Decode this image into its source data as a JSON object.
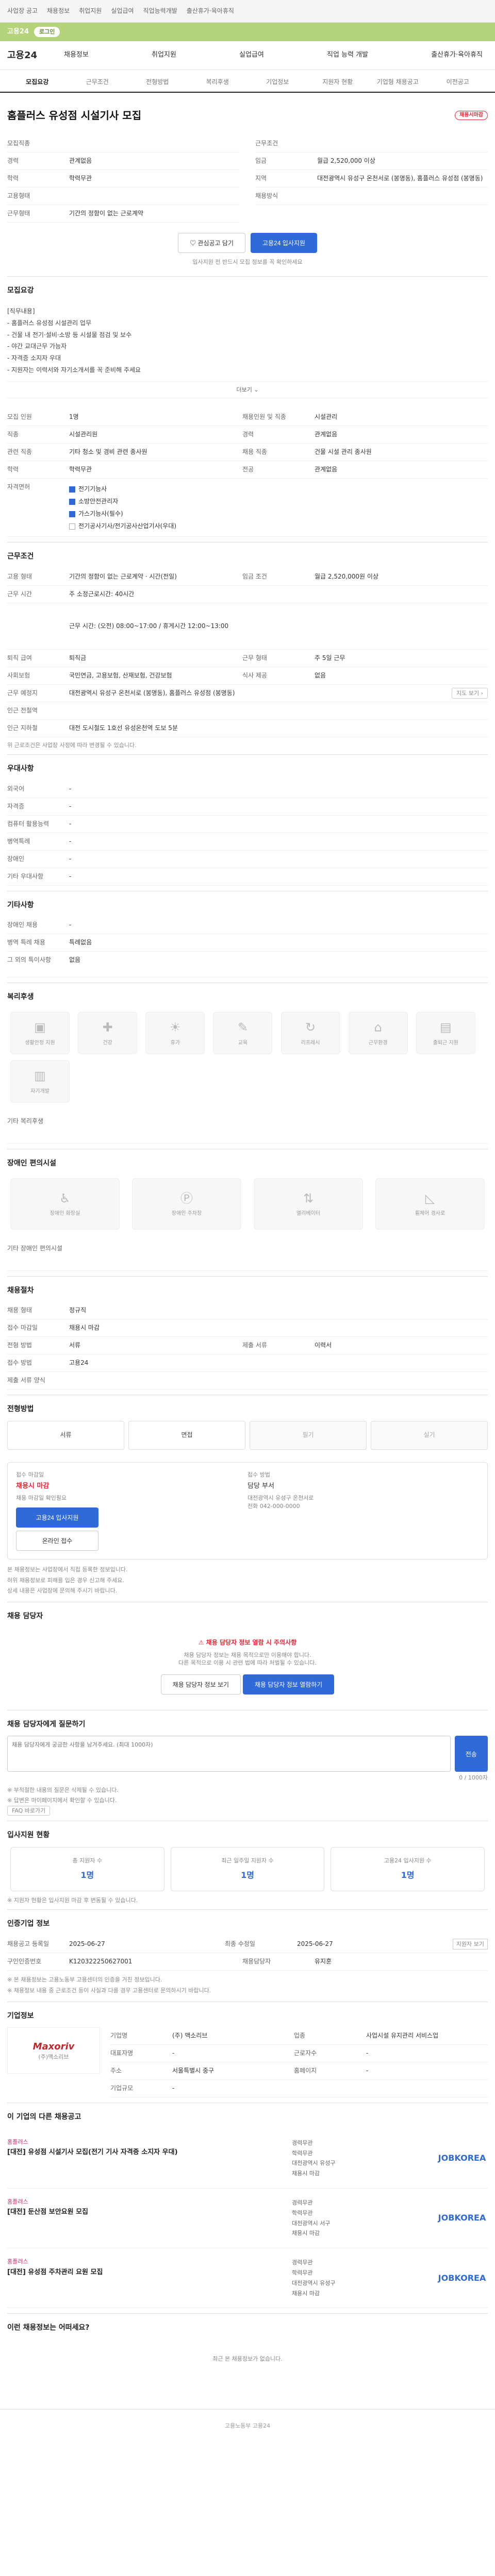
{
  "topbar": {
    "links": [
      "사업장 공고",
      "채용정보",
      "취업지원",
      "실업급여",
      "직업능력개발",
      "출산휴가·육아휴직"
    ]
  },
  "greenbar": {
    "text": "고용24",
    "pill": "로그인"
  },
  "nav": {
    "logo": "고용24",
    "menu": [
      "채용정보",
      "취업지원",
      "실업급여",
      "직업 능력 개발",
      "출산휴가·육아휴직"
    ]
  },
  "tabs": [
    "모집요강",
    "근무조건",
    "전형방법",
    "복리후생",
    "기업정보",
    "지원자 현황",
    "기업형 채용공고",
    "이전공고"
  ],
  "job": {
    "title": "홈플러스 유성점 시설기사 모집",
    "badge": "채용시마감",
    "left": [
      {
        "label": "모집직종",
        "value": ""
      },
      {
        "label": "경력",
        "value": "관계없음"
      },
      {
        "label": "학력",
        "value": "학력무관"
      },
      {
        "label": "고용형태",
        "value": ""
      },
      {
        "label": "근무형태",
        "value": "기간의 정함이 없는 근로계약"
      }
    ],
    "right": [
      {
        "label": "근무조건",
        "value": ""
      },
      {
        "label": "임금",
        "value": "월급 2,520,000 이상"
      },
      {
        "label": "지역",
        "value": "대전광역시 유성구 온천서로 (봉명동), 홈플러스 유성점 (봉명동)"
      },
      {
        "label": "채용방식",
        "value": ""
      }
    ],
    "btn_scrap": "관심공고 담기",
    "btn_apply": "고용24 입사지원",
    "note": "입사지원 전 반드시 모집 정보를 꼭 확인하세요"
  },
  "recruit": {
    "heading": "모집요강",
    "desc": [
      "[직무내용]",
      "- 홈플러스 유성점 시설관리 업무",
      "- 건물 내 전기·설비·소방 등 시설물 점검 및 보수",
      "- 야간 교대근무 가능자",
      "- 자격증 소지자 우대",
      "- 지원자는 이력서와 자기소개서를 꼭 준비해 주세요"
    ],
    "more": "더보기",
    "rows": [
      {
        "l": "모집 인원",
        "v": "1명",
        "l2": "채용인원 및 직종",
        "v2": "시설관리"
      },
      {
        "l": "직종",
        "v": "시설관리원",
        "l2": "경력",
        "v2": "관계없음"
      },
      {
        "l": "관련 직종",
        "v": "기타 청소 및 경비 관련 종사원",
        "l2": "채용 직종",
        "v2": "건물 시설 관리 종사원"
      },
      {
        "l": "학력",
        "v": "학력무관",
        "l2": "전공",
        "v2": "관계없음"
      },
      {
        "l": "자격면허",
        "v": "",
        "l2": "",
        "v2": ""
      }
    ],
    "licenses": [
      "전기기능사",
      "소방안전관리자",
      "가스기능사(필수)",
      "전기공사기사/전기공사산업기사(우대)"
    ]
  },
  "work": {
    "heading": "근무조건",
    "rows": [
      {
        "l": "고용 형태",
        "v": "기간의 정함이 없는 근로계약 · 시간(전일)",
        "l2": "임금 조건",
        "v2": "월급 2,520,000원 이상"
      },
      {
        "l": "근무 시간",
        "v": "주 소정근로시간: 40시간"
      },
      {
        "l": "",
        "v": "근무 시간: (오전) 08:00~17:00 / 휴게시간 12:00~13:00"
      },
      {
        "l": "퇴직 급여",
        "v": "퇴직금",
        "l2": "근무 형태",
        "v2": "주 5일 근무"
      },
      {
        "l": "사회보험",
        "v": "국민연금, 고용보험, 산재보험, 건강보험",
        "l2": "식사 제공",
        "v2": "없음"
      },
      {
        "l": "근무 예정지",
        "v": "대전광역시 유성구 온천서로 (봉명동), 홈플러스 유성점 (봉명동)"
      },
      {
        "l": "인근 전철역",
        "v": ""
      },
      {
        "l": "인근 지하철",
        "v": "대전 도시철도 1호선 유성온천역 도보 5분"
      }
    ],
    "note": "위 근로조건은 사업장 사정에 따라 변경될 수 있습니다."
  },
  "settle": {
    "heading": "우대사항",
    "rows": [
      {
        "l": "외국어",
        "v": "-"
      },
      {
        "l": "자격증",
        "v": "-"
      },
      {
        "l": "컴퓨터 활용능력",
        "v": "-"
      },
      {
        "l": "병역특례",
        "v": "-"
      },
      {
        "l": "장애인",
        "v": "-"
      },
      {
        "l": "기타 우대사항",
        "v": "-"
      }
    ]
  },
  "etc": {
    "heading": "기타사항",
    "rows": [
      {
        "l": "장애인 채용",
        "v": "-"
      },
      {
        "l": "병역 특례 채용",
        "v": "특례없음"
      }
    ],
    "extra": "그 외의 특이사항",
    "extra_v": "없음"
  },
  "welfare": {
    "heading": "복리후생",
    "items": [
      "생활안정 지원",
      "건강",
      "휴가",
      "교육",
      "리프레시",
      "근무환경",
      "출퇴근 지원",
      "자기개발"
    ],
    "label": "기타 복리후생",
    "value": ""
  },
  "disability": {
    "heading": "장애인 편의시설",
    "items": [
      "장애인 화장실",
      "장애인 주차장",
      "엘리베이터",
      "휠체어 경사로"
    ],
    "label": "기타 장애인 편의시설",
    "value": ""
  },
  "apply": {
    "heading": "채용절차",
    "rows": [
      {
        "l": "채용 형태",
        "v": "정규직",
        "l2": "",
        "v2": ""
      },
      {
        "l": "접수 마감일",
        "v": "채용시 마감",
        "l2": "",
        "v2": ""
      },
      {
        "l": "전형 방법",
        "v": "서류",
        "l2": "제출 서류",
        "v2": "이력서"
      },
      {
        "l": "접수 방법",
        "v": "고용24",
        "l2": "",
        "v2": ""
      },
      {
        "l": "제출 서류 양식",
        "v": "",
        "l2": "",
        "v2": ""
      }
    ]
  },
  "steps": {
    "heading": "전형방법",
    "items": [
      "서류",
      "면접",
      "필기",
      "실기"
    ],
    "dim": [
      false,
      false,
      true,
      true
    ]
  },
  "contact": {
    "l1": "접수 마감일",
    "v1": "채용시 마감",
    "sub": "채용 마감일 확인필요",
    "btn": "고용24 입사지원",
    "btn2": "온라인 접수",
    "l2": "접수 방법",
    "v2": "담당 부서",
    "v3": "대전광역시 유성구 온천서로",
    "v4": "전화 042-000-0000",
    "notes": [
      "본 채용정보는 사업장에서 직접 등록한 정보입니다.",
      "허위 채용정보로 피해를 입은 경우 신고해 주세요.",
      "상세 내용은 사업장에 문의해 주시기 바랍니다."
    ]
  },
  "manager": {
    "heading": "채용 담당자",
    "warn_t": "채용 담당자 정보 열람 시 주의사항",
    "warn_l": [
      "채용 담당자 정보는 채용 목적으로만 이용해야 합니다.",
      "다른 목적으로 이용 시 관련 법에 따라 처벌될 수 있습니다."
    ],
    "btn1": "채용 담당자 정보 보기",
    "btn2": "채용 담당자 정보 열람하기"
  },
  "qna": {
    "heading": "채용 담당자에게 질문하기",
    "placeholder": "채용 담당자에게 궁금한 사항을 남겨주세요. (최대 1000자)",
    "count": "0 / 1000자",
    "send": "전송",
    "notes": [
      "※ 부적절한 내용의 질문은 삭제될 수 있습니다.",
      "※ 답변은 마이페이지에서 확인할 수 있습니다."
    ],
    "link": "FAQ 바로가기"
  },
  "stats": {
    "heading": "입사지원 현황",
    "items": [
      {
        "t": "총 지원자 수",
        "n": "1명"
      },
      {
        "t": "최근 일주일 지원자 수",
        "n": "1명"
      },
      {
        "t": "고용24 입사지원 수",
        "n": "1명"
      }
    ],
    "note": "※ 지원자 현황은 입사지원 마감 후 변동될 수 있습니다."
  },
  "info": {
    "heading": "인증기업 정보",
    "rows": [
      {
        "l": "채용공고 등록일",
        "v": "2025-06-27",
        "l2": "최종 수정일",
        "v2": "2025-06-27",
        "tag": "지원자 보기"
      },
      {
        "l": "구인인증번호",
        "v": "K120322250627001",
        "l2": "채용담당자",
        "v2": "유지훈"
      }
    ],
    "notes": [
      "※ 본 채용정보는 고용노동부 고용센터의 인증을 거친 정보입니다.",
      "※ 채용정보 내용 중 근로조건 등이 사실과 다를 경우 고용센터로 문의하시기 바랍니다."
    ]
  },
  "company": {
    "heading": "기업정보",
    "logo": "Maxoriv",
    "name": "(주)맥소리브",
    "rows": [
      {
        "l": "기업명",
        "v": "(주) 맥소리브",
        "l2": "업종",
        "v2": "사업시설 유지관리 서비스업"
      },
      {
        "l": "대표자명",
        "v": "-",
        "l2": "근로자수",
        "v2": "-"
      },
      {
        "l": "주소",
        "v": "서울특별시 중구",
        "l2": "홈페이지",
        "v2": "-"
      },
      {
        "l": "기업규모",
        "v": "-",
        "l2": "",
        "v2": ""
      }
    ]
  },
  "others": {
    "heading": "이 기업의 다른 채용공고",
    "items": [
      {
        "co": "홈플러스",
        "title": "[대전] 유성점 시설기사 모집(전기 기사 자격증 소지자 우대)",
        "info": [
          "경력무관",
          "학력무관",
          "대전광역시 유성구",
          "채용시 마감"
        ],
        "logo": "JOBKOREA"
      },
      {
        "co": "홈플러스",
        "title": "[대전] 둔산점 보안요원 모집",
        "info": [
          "경력무관",
          "학력무관",
          "대전광역시 서구",
          "채용시 마감"
        ],
        "logo": "JOBKOREA"
      },
      {
        "co": "홈플러스",
        "title": "[대전] 유성점 주차관리 요원 모집",
        "info": [
          "경력무관",
          "학력무관",
          "대전광역시 유성구",
          "채용시 마감"
        ],
        "logo": "JOBKOREA"
      }
    ]
  },
  "recent": {
    "heading": "이런 채용정보는 어떠세요?",
    "empty": "최근 본 채용정보가 없습니다."
  },
  "footer": {
    "text": "고용노동부 고용24"
  }
}
